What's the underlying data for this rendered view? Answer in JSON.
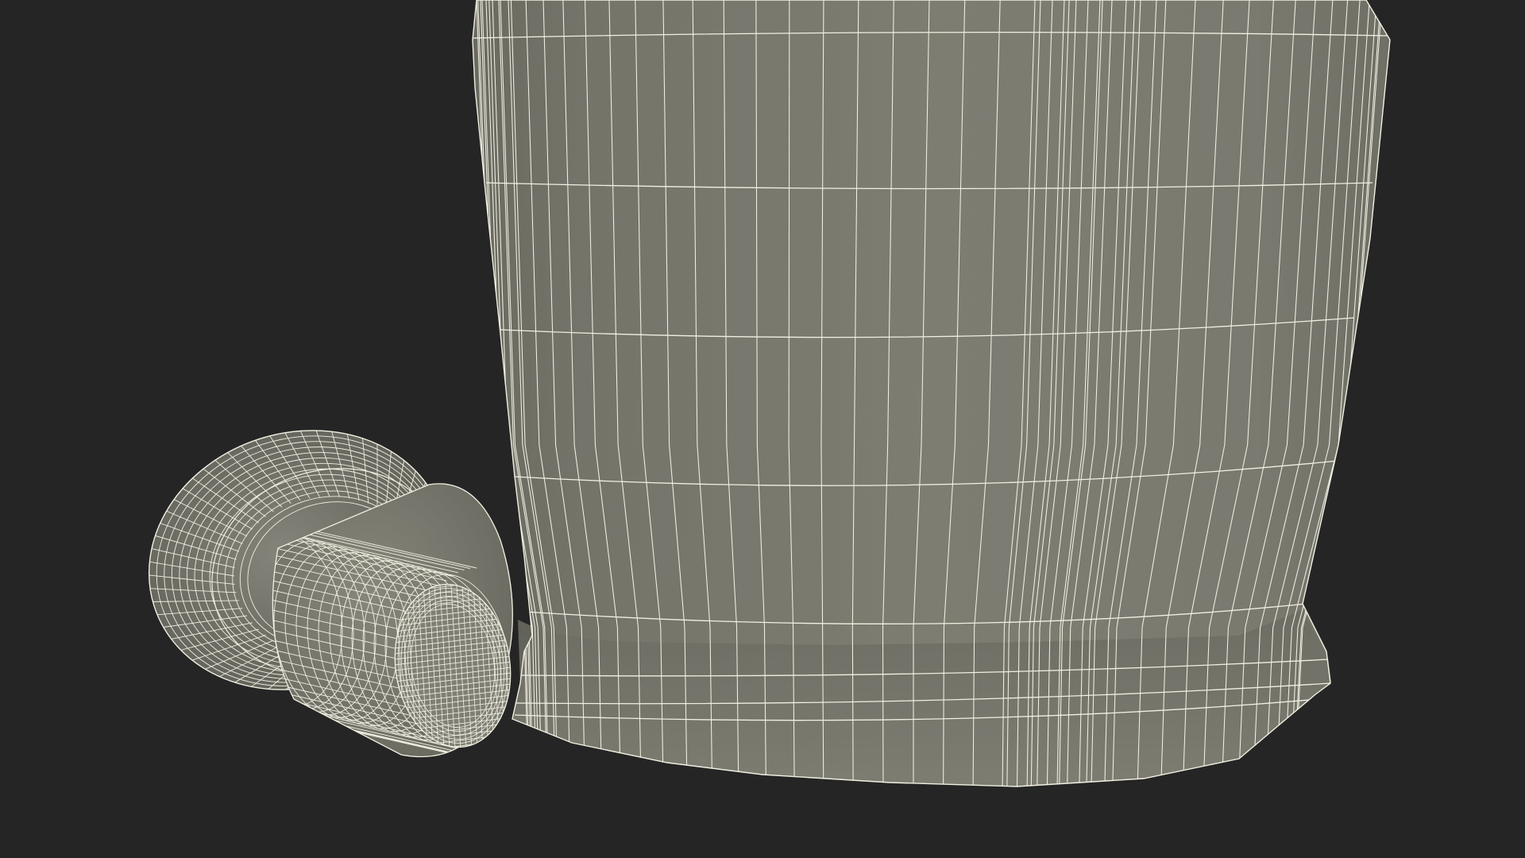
{
  "scene": {
    "background_color": "#252525",
    "mesh_fill_color": "#7b7b70",
    "mesh_shade_color": "#5f5f57",
    "wire_color": "#f2f0e2",
    "objects": [
      "bottle-body",
      "stopper-cap"
    ]
  }
}
